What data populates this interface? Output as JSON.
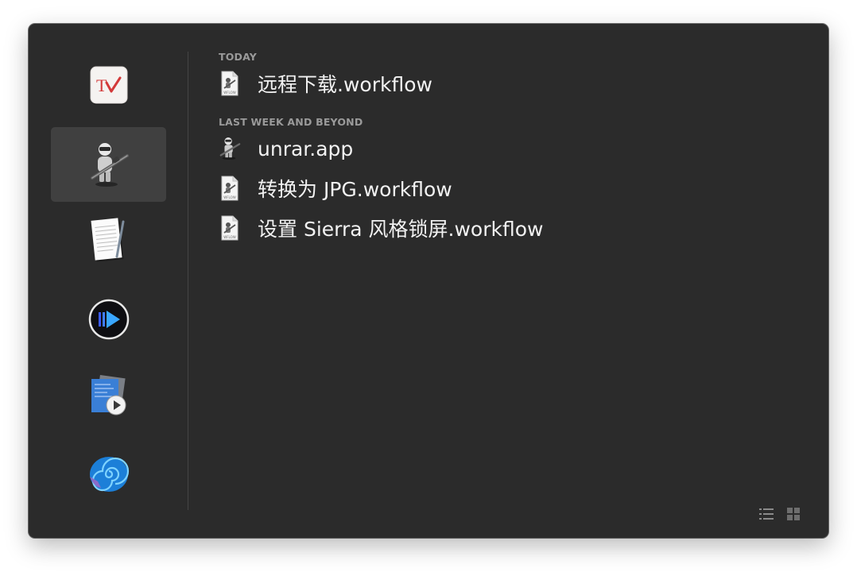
{
  "sidebar": {
    "items": [
      {
        "icon": "omnifocus-app-icon",
        "selected": false
      },
      {
        "icon": "automator-app-icon",
        "selected": true
      },
      {
        "icon": "textedit-app-icon",
        "selected": false
      },
      {
        "icon": "infuse-app-icon",
        "selected": false
      },
      {
        "icon": "script-editor-app-icon",
        "selected": false
      },
      {
        "icon": "nautilus-shell-app-icon",
        "selected": false
      },
      {
        "icon": "mail-app-icon",
        "selected": false
      }
    ]
  },
  "sections": [
    {
      "header": "TODAY",
      "files": [
        {
          "name": "远程下载.workflow",
          "icon": "workflow-file-icon"
        }
      ]
    },
    {
      "header": "LAST WEEK AND BEYOND",
      "files": [
        {
          "name": "unrar.app",
          "icon": "automator-app-file-icon"
        },
        {
          "name": "转换为 JPG.workflow",
          "icon": "workflow-file-icon"
        },
        {
          "name": "设置 Sierra 风格锁屏.workflow",
          "icon": "workflow-file-icon"
        }
      ]
    }
  ],
  "colors": {
    "window_bg": "#2b2b2b",
    "selected_bg": "#404040",
    "header_text": "#9a9a9a",
    "file_text": "#f2f2f2"
  },
  "view_controls": {
    "list_icon": "list-view-icon",
    "grid_icon": "grid-view-icon"
  }
}
